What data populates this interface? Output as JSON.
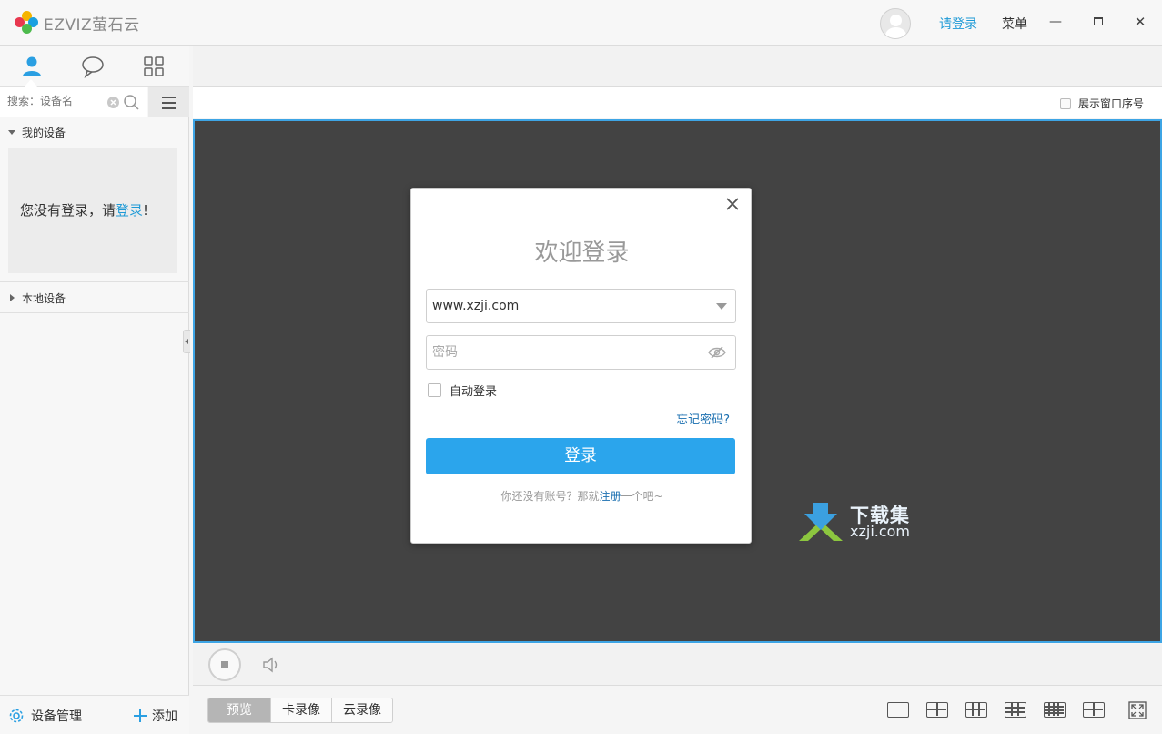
{
  "app": {
    "logo_text": "EZVIZ萤石云",
    "login_link": "请登录",
    "menu_label": "菜单",
    "minimize": "—",
    "maximize": "□",
    "close": "✕"
  },
  "sidebar": {
    "tabs": [
      {
        "name": "person-icon",
        "active": true
      },
      {
        "name": "chat-bubble-icon",
        "active": false
      },
      {
        "name": "grid-icon",
        "active": false
      }
    ],
    "search_placeholder": "搜索：设备名",
    "groups": {
      "my_devices": "我的设备",
      "local_devices": "本地设备"
    },
    "nologin_prefix": "您没有登录，请",
    "nologin_link": "登录",
    "nologin_suffix": "!",
    "device_manage": "设备管理",
    "add": "添加"
  },
  "main": {
    "show_window_index": "展示窗口序号"
  },
  "dialog": {
    "title": "欢迎登录",
    "account_value": "www.xzji.com",
    "password_placeholder": "密码",
    "auto_login": "自动登录",
    "forgot": "忘记密码?",
    "submit": "登录",
    "register_prefix": "你还没有账号？那就",
    "register_link": "注册",
    "register_suffix": "一个吧~"
  },
  "watermark": {
    "title": "下载集",
    "sub": "xzji.com"
  },
  "bottom": {
    "tabs": [
      "预览",
      "卡录像",
      "云录像"
    ]
  },
  "colors": {
    "accent": "#2ba5ec",
    "link": "#1e9ad6",
    "video_bg": "#434343",
    "video_border": "#3ea5e5"
  }
}
